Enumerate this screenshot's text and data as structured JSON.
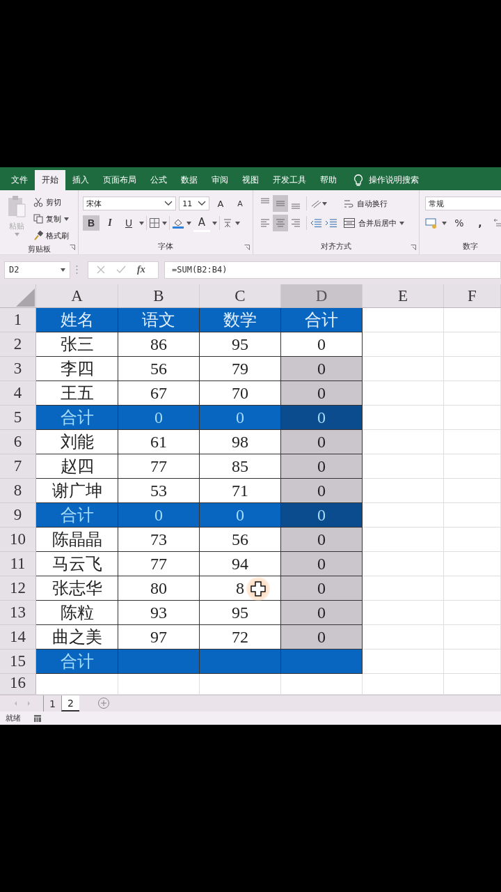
{
  "ribbon_tabs": [
    {
      "label": "文件",
      "selected": false
    },
    {
      "label": "开始",
      "selected": true
    },
    {
      "label": "插入",
      "selected": false
    },
    {
      "label": "页面布局",
      "selected": false
    },
    {
      "label": "公式",
      "selected": false
    },
    {
      "label": "数据",
      "selected": false
    },
    {
      "label": "审阅",
      "selected": false
    },
    {
      "label": "视图",
      "selected": false
    },
    {
      "label": "开发工具",
      "selected": false
    },
    {
      "label": "帮助",
      "selected": false
    }
  ],
  "tell_me": "操作说明搜索",
  "clipboard": {
    "paste": "粘贴",
    "cut": "剪切",
    "copy": "复制",
    "format_painter": "格式刷",
    "group": "剪贴板"
  },
  "font": {
    "name": "宋体",
    "size": "11",
    "grow": "A",
    "shrink": "A",
    "styles": [
      {
        "label": "B",
        "kind": "bold",
        "selected": true
      },
      {
        "label": "I",
        "kind": "italic",
        "selected": false
      },
      {
        "label": "U",
        "kind": "underline",
        "selected": false
      }
    ],
    "font_color": "A",
    "group": "字体"
  },
  "alignment": {
    "vertical": [
      {
        "kind": "top",
        "selected": false
      },
      {
        "kind": "middle",
        "selected": true
      },
      {
        "kind": "bottom",
        "selected": false
      }
    ],
    "horizontal": [
      {
        "kind": "left",
        "selected": false
      },
      {
        "kind": "center",
        "selected": true
      },
      {
        "kind": "right",
        "selected": false
      }
    ],
    "wrap": "自动换行",
    "merge": "合并后居中",
    "group": "对齐方式"
  },
  "number": {
    "format": "常规",
    "percent": "%",
    "comma": ",",
    "group": "数字"
  },
  "formula_bar": {
    "name_box": "D2",
    "function_button": "fx",
    "formula": "=SUM(B2:B4)"
  },
  "columns": [
    {
      "label": "A",
      "selected": false
    },
    {
      "label": "B",
      "selected": false
    },
    {
      "label": "C",
      "selected": false
    },
    {
      "label": "D",
      "selected": true
    },
    {
      "label": "E",
      "selected": false
    },
    {
      "label": "F",
      "selected": false
    }
  ],
  "rows": [
    {
      "number": "1",
      "kind": "header",
      "cells": [
        {
          "text": "姓名",
          "selected": false
        },
        {
          "text": "语文",
          "selected": false
        },
        {
          "text": "数学",
          "selected": false
        },
        {
          "text": "合计",
          "selected": false
        }
      ]
    },
    {
      "number": "2",
      "kind": "data",
      "cells": [
        {
          "text": "张三",
          "selected": false
        },
        {
          "text": "86",
          "selected": false
        },
        {
          "text": "95",
          "selected": false
        },
        {
          "text": "0",
          "selected": false
        }
      ]
    },
    {
      "number": "3",
      "kind": "data",
      "cells": [
        {
          "text": "李四",
          "selected": false
        },
        {
          "text": "56",
          "selected": false
        },
        {
          "text": "79",
          "selected": false
        },
        {
          "text": "0",
          "selected": true
        }
      ]
    },
    {
      "number": "4",
      "kind": "data",
      "cells": [
        {
          "text": "王五",
          "selected": false
        },
        {
          "text": "67",
          "selected": false
        },
        {
          "text": "70",
          "selected": false
        },
        {
          "text": "0",
          "selected": true
        }
      ]
    },
    {
      "number": "5",
      "kind": "total",
      "cells": [
        {
          "text": "合计",
          "selected": false
        },
        {
          "text": "0",
          "selected": false
        },
        {
          "text": "0",
          "selected": false
        },
        {
          "text": "0",
          "selected": true
        }
      ]
    },
    {
      "number": "6",
      "kind": "data",
      "cells": [
        {
          "text": "刘能",
          "selected": false
        },
        {
          "text": "61",
          "selected": false
        },
        {
          "text": "98",
          "selected": false
        },
        {
          "text": "0",
          "selected": true
        }
      ]
    },
    {
      "number": "7",
      "kind": "data",
      "cells": [
        {
          "text": "赵四",
          "selected": false
        },
        {
          "text": "77",
          "selected": false
        },
        {
          "text": "85",
          "selected": false
        },
        {
          "text": "0",
          "selected": true
        }
      ]
    },
    {
      "number": "8",
      "kind": "data",
      "cells": [
        {
          "text": "谢广坤",
          "selected": false
        },
        {
          "text": "53",
          "selected": false
        },
        {
          "text": "71",
          "selected": false
        },
        {
          "text": "0",
          "selected": true
        }
      ]
    },
    {
      "number": "9",
      "kind": "total",
      "cells": [
        {
          "text": "合计",
          "selected": false
        },
        {
          "text": "0",
          "selected": false
        },
        {
          "text": "0",
          "selected": false
        },
        {
          "text": "0",
          "selected": true
        }
      ]
    },
    {
      "number": "10",
      "kind": "data",
      "cells": [
        {
          "text": "陈晶晶",
          "selected": false
        },
        {
          "text": "73",
          "selected": false
        },
        {
          "text": "56",
          "selected": false
        },
        {
          "text": "0",
          "selected": true
        }
      ]
    },
    {
      "number": "11",
      "kind": "data",
      "cells": [
        {
          "text": "马云飞",
          "selected": false
        },
        {
          "text": "77",
          "selected": false
        },
        {
          "text": "94",
          "selected": false
        },
        {
          "text": "0",
          "selected": true
        }
      ]
    },
    {
      "number": "12",
      "kind": "data",
      "cells": [
        {
          "text": "张志华",
          "selected": false
        },
        {
          "text": "80",
          "selected": false
        },
        {
          "text": "8",
          "selected": false,
          "pointer": true
        },
        {
          "text": "0",
          "selected": true
        }
      ]
    },
    {
      "number": "13",
      "kind": "data",
      "cells": [
        {
          "text": "陈粒",
          "selected": false
        },
        {
          "text": "93",
          "selected": false
        },
        {
          "text": "95",
          "selected": false
        },
        {
          "text": "0",
          "selected": true
        }
      ]
    },
    {
      "number": "14",
      "kind": "data",
      "cells": [
        {
          "text": "曲之美",
          "selected": false
        },
        {
          "text": "97",
          "selected": false
        },
        {
          "text": "72",
          "selected": false
        },
        {
          "text": "0",
          "selected": true
        }
      ]
    },
    {
      "number": "15",
      "kind": "total",
      "cells": [
        {
          "text": "合计",
          "selected": false
        },
        {
          "selected": false
        },
        {
          "selected": false
        },
        {
          "selected": false
        }
      ]
    },
    {
      "number": "16",
      "kind": "empty"
    }
  ],
  "sheet_tabs": [
    {
      "label": "1",
      "selected": false
    },
    {
      "label": "2",
      "selected": true
    }
  ],
  "status": "就绪"
}
